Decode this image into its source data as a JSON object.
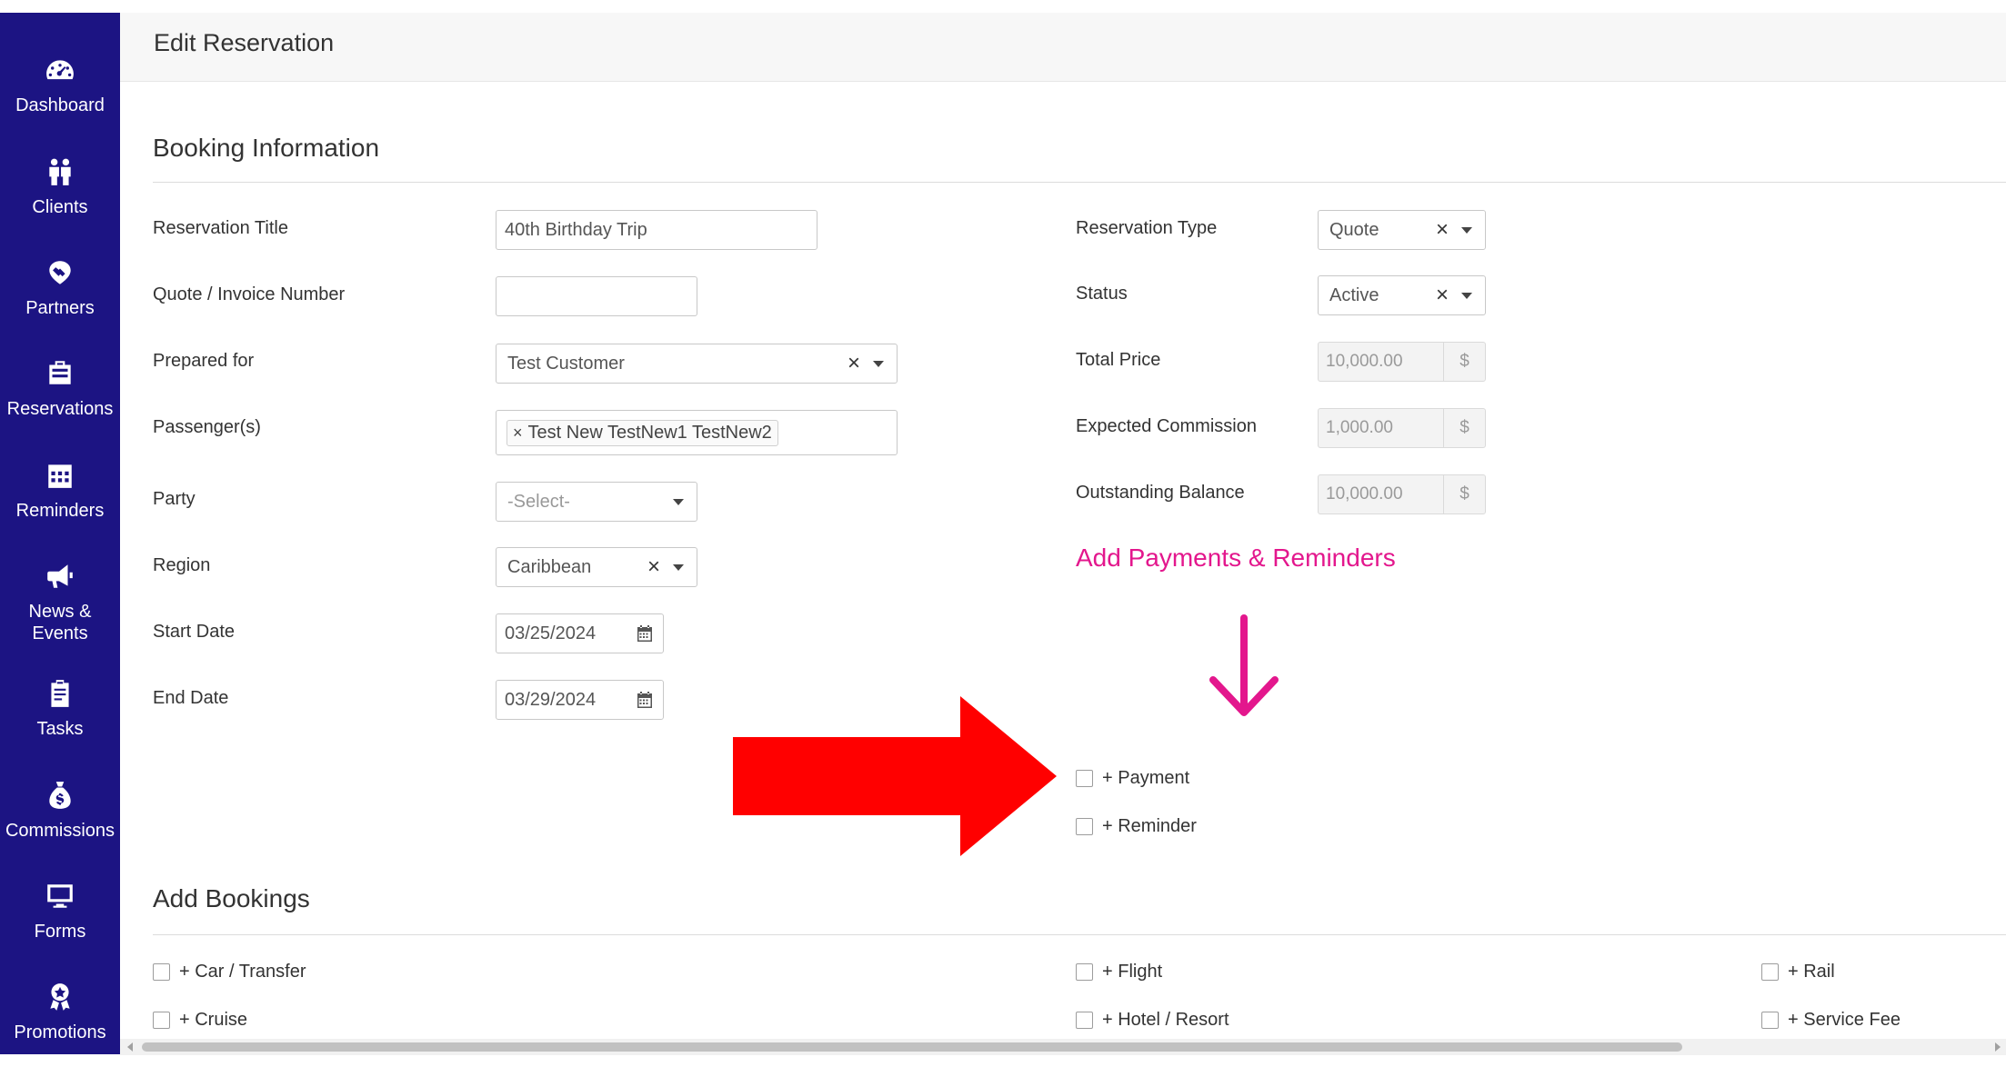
{
  "sidebar": {
    "items": [
      {
        "label": "Dashboard",
        "icon": "dashboard-gauge-icon"
      },
      {
        "label": "Clients",
        "icon": "clients-people-icon"
      },
      {
        "label": "Partners",
        "icon": "partners-handshake-icon"
      },
      {
        "label": "Reservations",
        "icon": "reservations-suitcase-icon"
      },
      {
        "label": "Reminders",
        "icon": "reminders-calendar-icon"
      },
      {
        "label": "News &\nEvents",
        "icon": "news-megaphone-icon"
      },
      {
        "label": "Tasks",
        "icon": "tasks-clipboard-icon"
      },
      {
        "label": "Commissions",
        "icon": "commissions-moneybag-icon"
      },
      {
        "label": "Forms",
        "icon": "forms-monitor-icon"
      },
      {
        "label": "Promotions",
        "icon": "promotions-award-icon"
      }
    ]
  },
  "header": {
    "title": "Edit Reservation"
  },
  "booking": {
    "title": "Booking Information",
    "reservation_title": {
      "label": "Reservation Title",
      "value": "40th Birthday Trip"
    },
    "quote_number": {
      "label": "Quote / Invoice Number",
      "value": ""
    },
    "prepared_for": {
      "label": "Prepared for",
      "value": "Test Customer"
    },
    "passengers": {
      "label": "Passenger(s)",
      "tags": [
        "Test New TestNew1 TestNew2"
      ]
    },
    "party": {
      "label": "Party",
      "placeholder": "-Select-"
    },
    "region": {
      "label": "Region",
      "value": "Caribbean"
    },
    "start_date": {
      "label": "Start Date",
      "value": "03/25/2024"
    },
    "end_date": {
      "label": "End Date",
      "value": "03/29/2024"
    },
    "reservation_type": {
      "label": "Reservation Type",
      "value": "Quote"
    },
    "status": {
      "label": "Status",
      "value": "Active"
    },
    "total_price": {
      "label": "Total Price",
      "value": "10,000.00",
      "currency": "$"
    },
    "expected_commission": {
      "label": "Expected Commission",
      "value": "1,000.00",
      "currency": "$"
    },
    "outstanding_balance": {
      "label": "Outstanding Balance",
      "value": "10,000.00",
      "currency": "$"
    },
    "add_payments_link": "Add Payments & Reminders",
    "payment_option": "+ Payment",
    "reminder_option": "+ Reminder"
  },
  "bookings": {
    "title": "Add Bookings",
    "options": [
      "+ Car / Transfer",
      "+ Flight",
      "+ Rail",
      "+ Cruise",
      "+ Hotel / Resort",
      "+ Service Fee"
    ]
  },
  "colors": {
    "sidebar_bg": "#1c1483",
    "accent_pink": "#e3178d",
    "annotation_red": "#ff0000"
  }
}
